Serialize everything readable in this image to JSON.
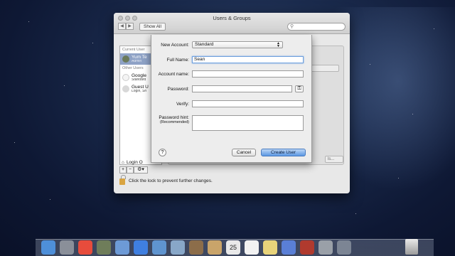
{
  "window": {
    "title": "Users & Groups",
    "nav_back": "◀",
    "nav_forward": "▶",
    "show_all": "Show All",
    "search_placeholder": ""
  },
  "sidebar": {
    "current_user_head": "Current User",
    "other_users_head": "Other Users",
    "users": [
      {
        "name": "Yum Te",
        "role": "Admin"
      },
      {
        "name": "Google",
        "role": "Standard"
      },
      {
        "name": "Guest U",
        "role": "Login, Sh"
      }
    ],
    "login_options": "Login O",
    "add": "+",
    "remove": "−",
    "gear": "⚙▾"
  },
  "main": {
    "ghost_buttons": [
      "",
      "...",
      "ls..."
    ],
    "lock_text": "Click the lock to prevent further changes."
  },
  "sheet": {
    "new_account_label": "New Account:",
    "new_account_value": "Standard",
    "full_name_label": "Full Name:",
    "full_name_value": "Sean",
    "account_name_label": "Account name:",
    "account_name_value": "",
    "password_label": "Password:",
    "password_value": "",
    "verify_label": "Verify:",
    "verify_value": "",
    "hint_label": "Password hint:",
    "hint_sub": "(Recommended)",
    "hint_value": "",
    "help": "?",
    "cancel": "Cancel",
    "create": "Create User",
    "key_icon": "🔑"
  },
  "dock": {
    "icons": [
      {
        "name": "finder-icon",
        "color": "#4e8fd9",
        "glyph": ""
      },
      {
        "name": "launchpad-icon",
        "color": "#8a8f99",
        "glyph": ""
      },
      {
        "name": "chrome-icon",
        "color": "#e74c3c",
        "glyph": ""
      },
      {
        "name": "photo-icon",
        "color": "#6f7d5a",
        "glyph": ""
      },
      {
        "name": "mail-stamp-icon",
        "color": "#6d9ad6",
        "glyph": ""
      },
      {
        "name": "app-store-icon",
        "color": "#3f7fe0",
        "glyph": ""
      },
      {
        "name": "safari-icon",
        "color": "#5f94cf",
        "glyph": ""
      },
      {
        "name": "mail-icon",
        "color": "#88a7c8",
        "glyph": ""
      },
      {
        "name": "contacts-icon",
        "color": "#8c6d4a",
        "glyph": ""
      },
      {
        "name": "address-book-icon",
        "color": "#c9a46a",
        "glyph": ""
      },
      {
        "name": "calendar-icon",
        "color": "#e9e9e9",
        "glyph": ""
      },
      {
        "name": "reminders-icon",
        "color": "#f2f2f2",
        "glyph": ""
      },
      {
        "name": "notes-icon",
        "color": "#e8d37a",
        "glyph": ""
      },
      {
        "name": "itunes-icon",
        "color": "#5a7fd6",
        "glyph": ""
      },
      {
        "name": "photo-booth-icon",
        "color": "#b03a2e",
        "glyph": ""
      },
      {
        "name": "system-preferences-icon",
        "color": "#9aa0a8",
        "glyph": ""
      },
      {
        "name": "downloads-icon",
        "color": "#7c8594",
        "glyph": ""
      }
    ],
    "calendar_day": "25"
  }
}
